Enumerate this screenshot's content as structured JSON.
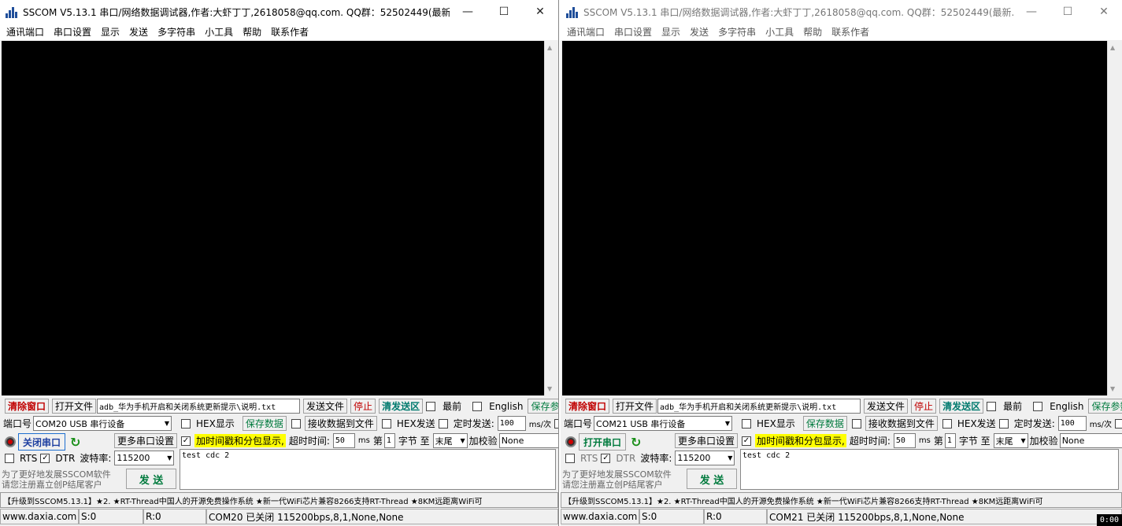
{
  "windows": [
    {
      "title": "SSCOM V5.13.1 串口/网络数据调试器,作者:大虾丁丁,2618058@qq.com. QQ群：52502449(最新...",
      "menu": [
        "通讯端口",
        "串口设置",
        "显示",
        "发送",
        "多字符串",
        "小工具",
        "帮助",
        "联系作者"
      ],
      "clear_btn": "清除窗口",
      "open_file_btn": "打开文件",
      "file_path": "adb_华为手机开启和关闭系统更新提示\\说明.txt",
      "send_file_btn": "发送文件",
      "stop_btn": "停止",
      "clear_send_btn": "清发送区",
      "topmost_label": "最前",
      "english_label": "English",
      "save_params_btn": "保存参数",
      "port_label": "端口号",
      "port_value": "COM20 USB 串行设备",
      "hex_display": "HEX显示",
      "save_data_btn": "保存数据",
      "recv_to_file": "接收数据到文件",
      "hex_send": "HEX发送",
      "timed_send": "定时发送:",
      "timed_value": "100",
      "ms_per": "ms/次",
      "open_port_btn": "关闭串口",
      "more_settings": "更多串口设置",
      "timestamp_label": "加时间戳和分包显示,",
      "timeout_label": "超时时间:",
      "timeout_value": "50",
      "ms": "ms",
      "nth": "第",
      "byte_idx": "1",
      "byte_to": "字节 至",
      "end_sel": "末尾",
      "checksum_label": "加校验",
      "checksum_value": "None",
      "rts": "RTS",
      "dtr": "DTR",
      "baud_label": "波特率:",
      "baud_value": "115200",
      "send_text": "test cdc 2",
      "note": "为了更好地发展SSCOM软件\n请您注册嘉立创P结尾客户",
      "send_btn": "发 送",
      "ticker": "【升级到SSCOM5.13.1】★2. ★RT-Thread中国人的开源免费操作系统 ★新一代WiFi芯片兼容8266支持RT-Thread ★8KM远距离WiFi可",
      "status": {
        "site": "www.daxia.com",
        "s": "S:0",
        "r": "R:0",
        "port": "COM20 已关闭  115200bps,8,1,None,None"
      },
      "port_open": true
    },
    {
      "title": "SSCOM V5.13.1 串口/网络数据调试器,作者:大虾丁丁,2618058@qq.com. QQ群：52502449(最新...",
      "menu": [
        "通讯端口",
        "串口设置",
        "显示",
        "发送",
        "多字符串",
        "小工具",
        "帮助",
        "联系作者"
      ],
      "clear_btn": "清除窗口",
      "open_file_btn": "打开文件",
      "file_path": "adb_华为手机开启和关闭系统更新提示\\说明.txt",
      "send_file_btn": "发送文件",
      "stop_btn": "停止",
      "clear_send_btn": "清发送区",
      "topmost_label": "最前",
      "english_label": "English",
      "save_params_btn": "保存参数",
      "port_label": "端口号",
      "port_value": "COM21 USB 串行设备",
      "hex_display": "HEX显示",
      "save_data_btn": "保存数据",
      "recv_to_file": "接收数据到文件",
      "hex_send": "HEX发送",
      "timed_send": "定时发送:",
      "timed_value": "100",
      "ms_per": "ms/次",
      "open_port_btn": "打开串口",
      "more_settings": "更多串口设置",
      "timestamp_label": "加时间戳和分包显示,",
      "timeout_label": "超时时间:",
      "timeout_value": "50",
      "ms": "ms",
      "nth": "第",
      "byte_idx": "1",
      "byte_to": "字节 至",
      "end_sel": "末尾",
      "checksum_label": "加校验",
      "checksum_value": "None",
      "rts": "RTS",
      "dtr": "DTR",
      "baud_label": "波特率:",
      "baud_value": "115200",
      "send_text": "test cdc 2",
      "note": "为了更好地发展SSCOM软件\n请您注册嘉立创P结尾客户",
      "send_btn": "发 送",
      "ticker": "【升级到SSCOM5.13.1】★2. ★RT-Thread中国人的开源免费操作系统 ★新一代WiFi芯片兼容8266支持RT-Thread ★8KM远距离WiFi可",
      "status": {
        "site": "www.daxia.com",
        "s": "S:0",
        "r": "R:0",
        "port": "COM21 已关闭  115200bps,8,1,None,None"
      },
      "port_open": false
    }
  ],
  "window_controls": {
    "minimize": "—",
    "maximize": "☐",
    "close": "✕"
  },
  "clock": "0:00",
  "colors": {
    "recv_bg": "#000000",
    "highlight": "#ffff00",
    "danger": "#c00000",
    "ok": "#007a3d"
  }
}
